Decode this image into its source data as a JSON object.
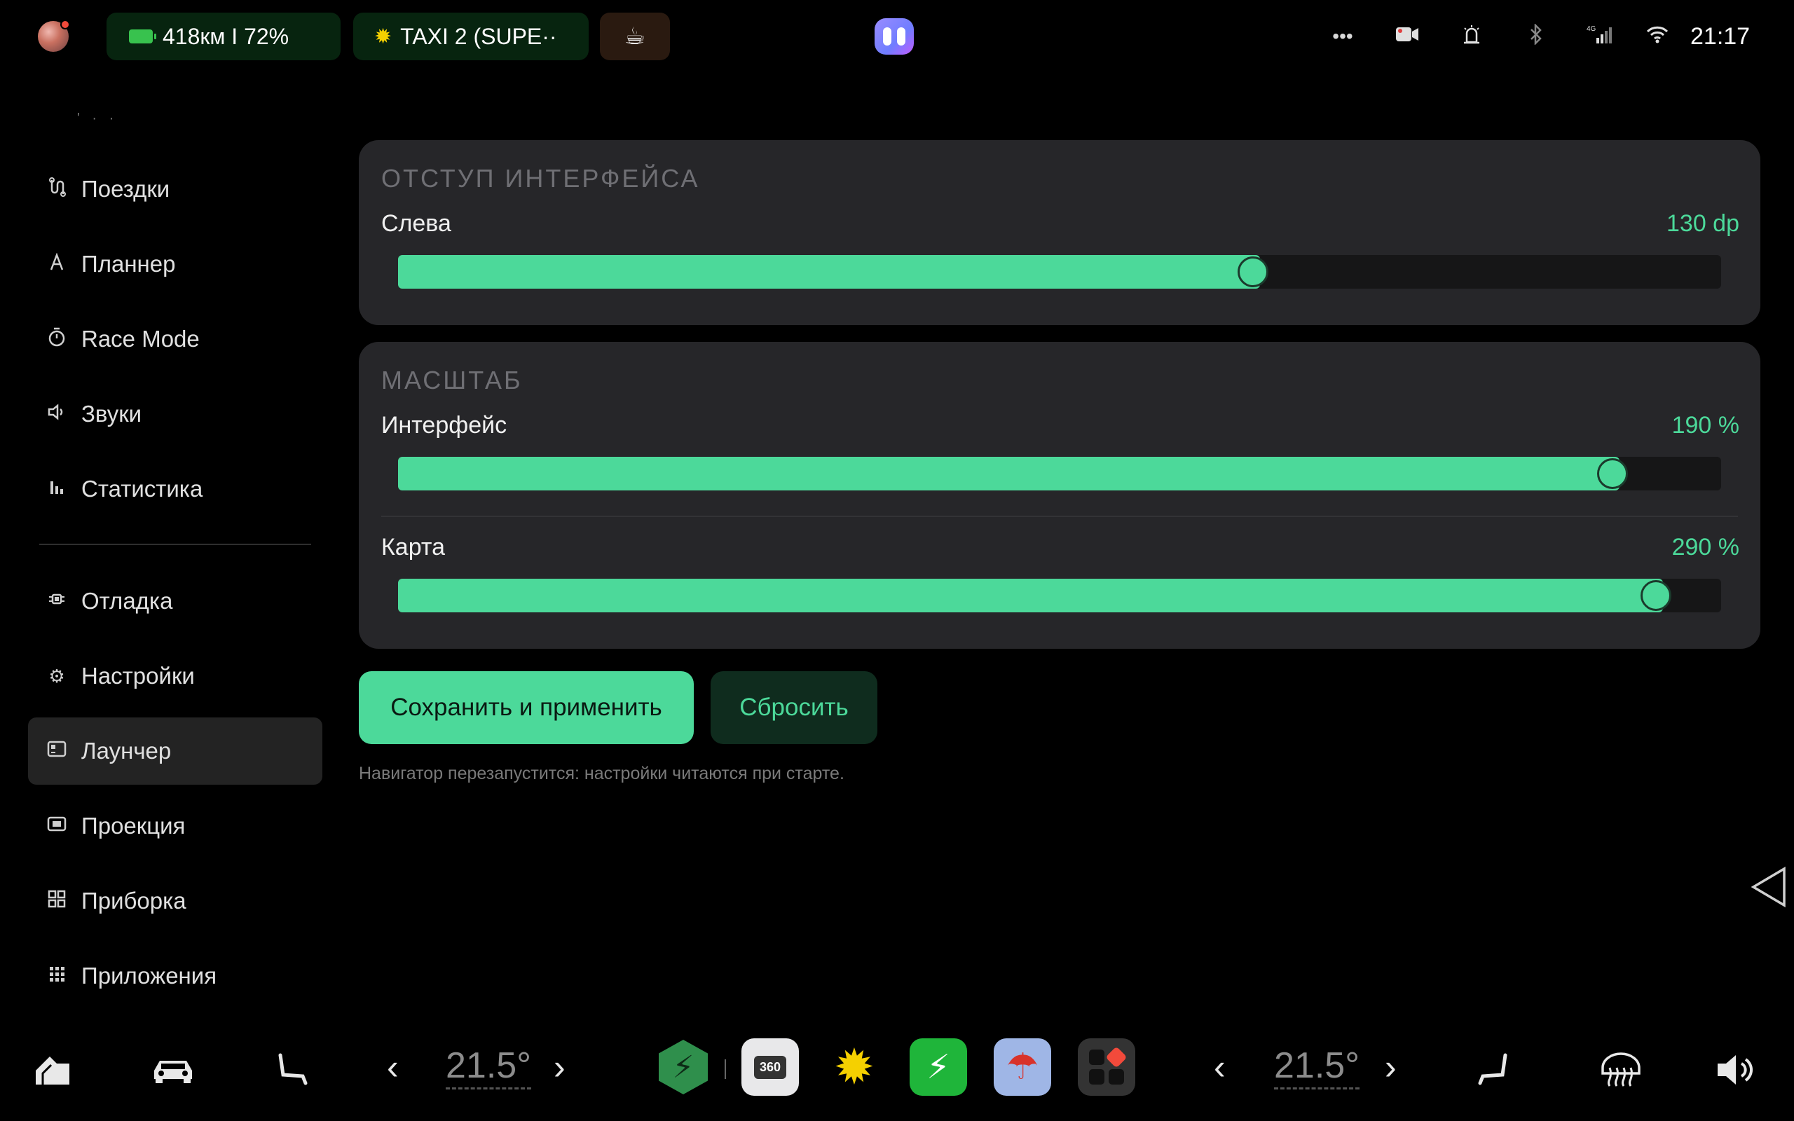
{
  "status_bar": {
    "battery_text": "418км I 72%",
    "taxi_text": "TAXI 2 (SUPE··",
    "cup_icon": "cup-icon",
    "alice_icon": "alice-icon",
    "icons": [
      "more-icon",
      "dashcam-icon",
      "alarm-icon",
      "bluetooth-icon",
      "signal-icon",
      "wifi-icon"
    ],
    "signal_label": "4G",
    "time": "21:17"
  },
  "sidebar": {
    "partial_label": "' · ·",
    "items": [
      {
        "label": "Поездки",
        "icon": "route-icon"
      },
      {
        "label": "Планнер",
        "icon": "planner-icon"
      },
      {
        "label": "Race Mode",
        "icon": "stopwatch-icon"
      },
      {
        "label": "Звуки",
        "icon": "speaker-icon"
      },
      {
        "label": "Статистика",
        "icon": "bar-chart-icon"
      },
      {
        "label": "Отладка",
        "icon": "bug-icon"
      },
      {
        "label": "Настройки",
        "icon": "gear-icon"
      },
      {
        "label": "Лаунчер",
        "icon": "launcher-icon",
        "active": true
      },
      {
        "label": "Проекция",
        "icon": "projection-icon"
      },
      {
        "label": "Приборка",
        "icon": "dashboard-icon"
      },
      {
        "label": "Приложения",
        "icon": "apps-grid-icon"
      }
    ]
  },
  "main": {
    "inset_card": {
      "title": "ОТСТУП ИНТЕРФЕЙСА",
      "sliders": [
        {
          "label": "Слева",
          "value_text": "130 dp",
          "fraction": 0.646
        }
      ]
    },
    "scale_card": {
      "title": "МАСШТАБ",
      "sliders": [
        {
          "label": "Интерфейс",
          "value_text": "190 %",
          "fraction": 0.918
        },
        {
          "label": "Карта",
          "value_text": "290 %",
          "fraction": 0.951
        }
      ]
    },
    "save_label": "Сохранить и применить",
    "reset_label": "Сбросить",
    "hint": "Навигатор перезапустится: настройки читаются при старте."
  },
  "dock": {
    "left_temp": "21.5°",
    "right_temp": "21.5°",
    "app_360_label": "360",
    "colors": {
      "accent": "#4cd99a",
      "background": "#000000",
      "card": "#262629"
    }
  }
}
